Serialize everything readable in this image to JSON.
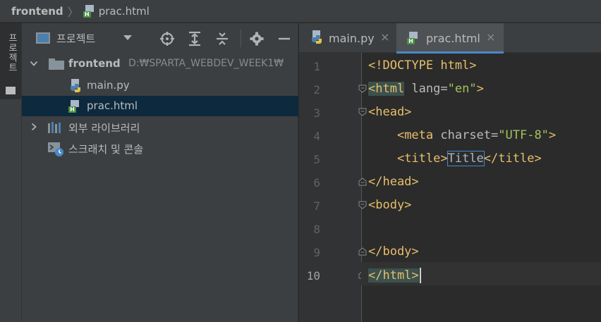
{
  "breadcrumb": {
    "root": "frontend",
    "separator": "〉",
    "file": "prac.html",
    "file_icon": "html-file-icon"
  },
  "tool_strip": {
    "project_label": "프로젝트"
  },
  "project_panel": {
    "title": "프로젝트",
    "toolbar_icons": [
      "locate-icon",
      "expand-all-icon",
      "collapse-all-icon",
      "gear-icon",
      "minimize-icon"
    ],
    "tree": [
      {
        "label": "frontend",
        "hint": "D:₩SPARTA_WEBDEV_WEEK1₩",
        "icon": "folder-icon",
        "expanded": true
      },
      {
        "label": "main.py",
        "icon": "python-file-icon"
      },
      {
        "label": "prac.html",
        "icon": "html-file-icon",
        "selected": true
      },
      {
        "label": "외부 라이브러리",
        "icon": "library-icon",
        "expanded": false
      },
      {
        "label": "스크래치 및 콘솔",
        "icon": "scratch-icon"
      }
    ]
  },
  "editor": {
    "tabs": [
      {
        "label": "main.py",
        "icon": "python-file-icon",
        "close": "×"
      },
      {
        "label": "prac.html",
        "icon": "html-file-icon",
        "close": "×",
        "active": true
      }
    ],
    "line_numbers": [
      "1",
      "2",
      "3",
      "4",
      "5",
      "6",
      "7",
      "8",
      "9",
      "10"
    ],
    "current_line": 10,
    "lines": {
      "l1": {
        "tag": "<!DOCTYPE html>"
      },
      "l2": {
        "open": "<html",
        "attr": " lang=",
        "val": "\"en\"",
        "close": ">"
      },
      "l3": {
        "tag": "<head>"
      },
      "l4": {
        "indent": "    ",
        "open": "<meta",
        "attr": " charset=",
        "val": "\"UTF-8\"",
        "close": ">"
      },
      "l5": {
        "indent": "    ",
        "open": "<title>",
        "text": "Title",
        "close": "</title>"
      },
      "l6": {
        "tag": "</head>"
      },
      "l7": {
        "tag": "<body>"
      },
      "l8": {
        "tag": ""
      },
      "l9": {
        "tag": "</body>"
      },
      "l10": {
        "tag": "</html>"
      }
    }
  },
  "colors": {
    "tag": "#e8bf6a",
    "attribute": "#bababa",
    "value": "#a5c25c",
    "text": "#a9b7c6",
    "selection": "#0d293e",
    "accent": "#4a88c7"
  }
}
